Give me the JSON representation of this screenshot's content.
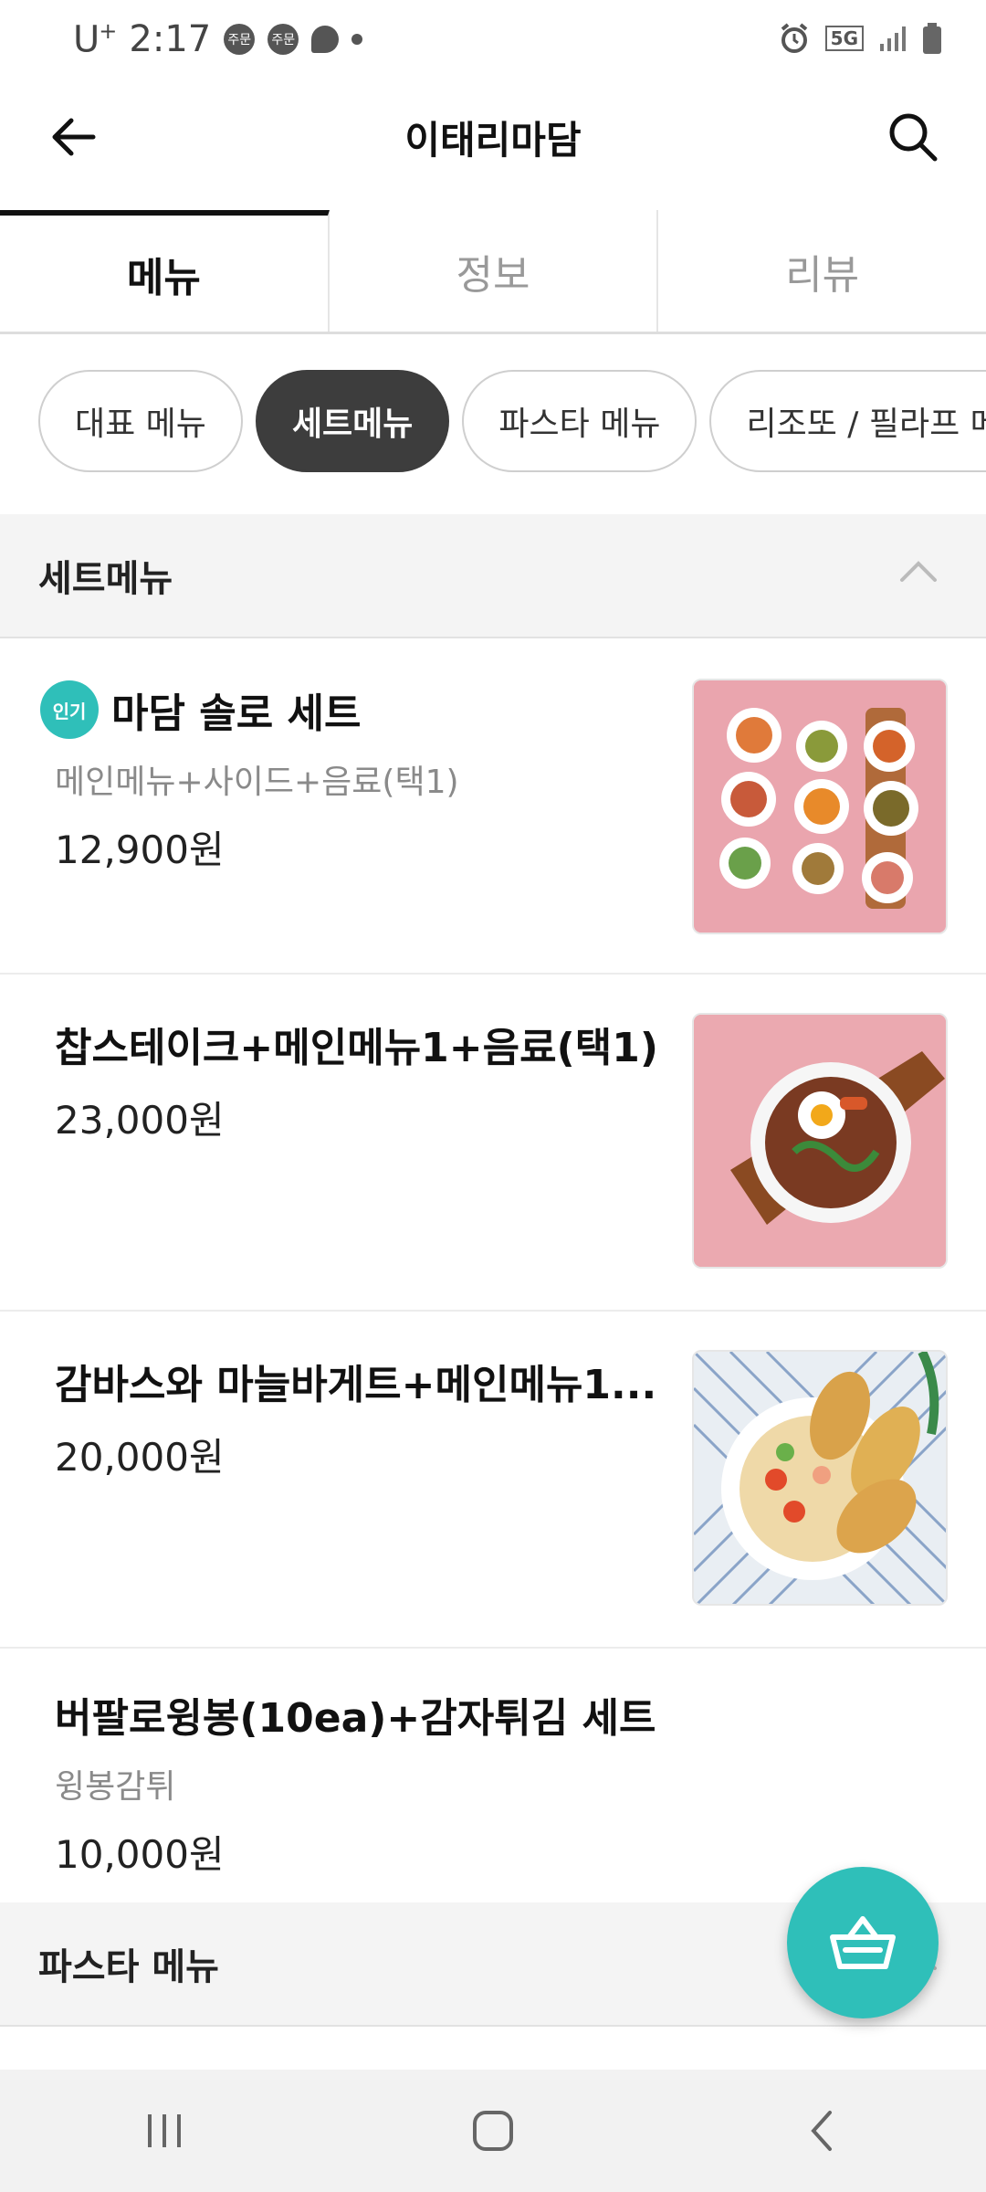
{
  "status_bar": {
    "carrier": "U",
    "carrier_sup": "+",
    "time": "2:17",
    "badge1": "주문",
    "badge2": "주문",
    "network": "5G"
  },
  "header": {
    "title": "이태리마담",
    "back_icon": "arrow-left-icon",
    "search_icon": "search-icon"
  },
  "tabs": [
    {
      "label": "메뉴",
      "active": true
    },
    {
      "label": "정보",
      "active": false
    },
    {
      "label": "리뷰",
      "active": false
    }
  ],
  "chips": [
    {
      "label": "대표 메뉴",
      "active": false
    },
    {
      "label": "세트메뉴",
      "active": true
    },
    {
      "label": "파스타 메뉴",
      "active": false
    },
    {
      "label": "리조또 / 필라프 메뉴",
      "active": false
    }
  ],
  "sections": {
    "set_menu": {
      "title": "세트메뉴",
      "expanded": true
    },
    "pasta_menu": {
      "title": "파스타 메뉴"
    }
  },
  "items": [
    {
      "badge": "인기",
      "name": "마담 솔로 세트",
      "desc": "메인메뉴+사이드+음료(택1)",
      "price": "12,900원",
      "image": "food-platter-photo"
    },
    {
      "name": "찹스테이크+메인메뉴1+음료(택1)",
      "price": "23,000원",
      "image": "steak-bowl-photo"
    },
    {
      "name": "감바스와 마늘바게트+메인메뉴1...",
      "price": "20,000원",
      "image": "gambas-photo"
    },
    {
      "name": "버팔로윙봉(10ea)+감자튀김 세트",
      "desc": "윙봉감튀",
      "price": "10,000원"
    }
  ],
  "fab": {
    "icon": "basket-icon"
  },
  "colors": {
    "accent": "#2fbfb9",
    "chip_active": "#3d3d3d",
    "thumb_pink": "#e8a4ae"
  },
  "nav": {
    "recent_icon": "recent-apps-icon",
    "home_icon": "home-icon",
    "back_icon": "back-icon"
  }
}
